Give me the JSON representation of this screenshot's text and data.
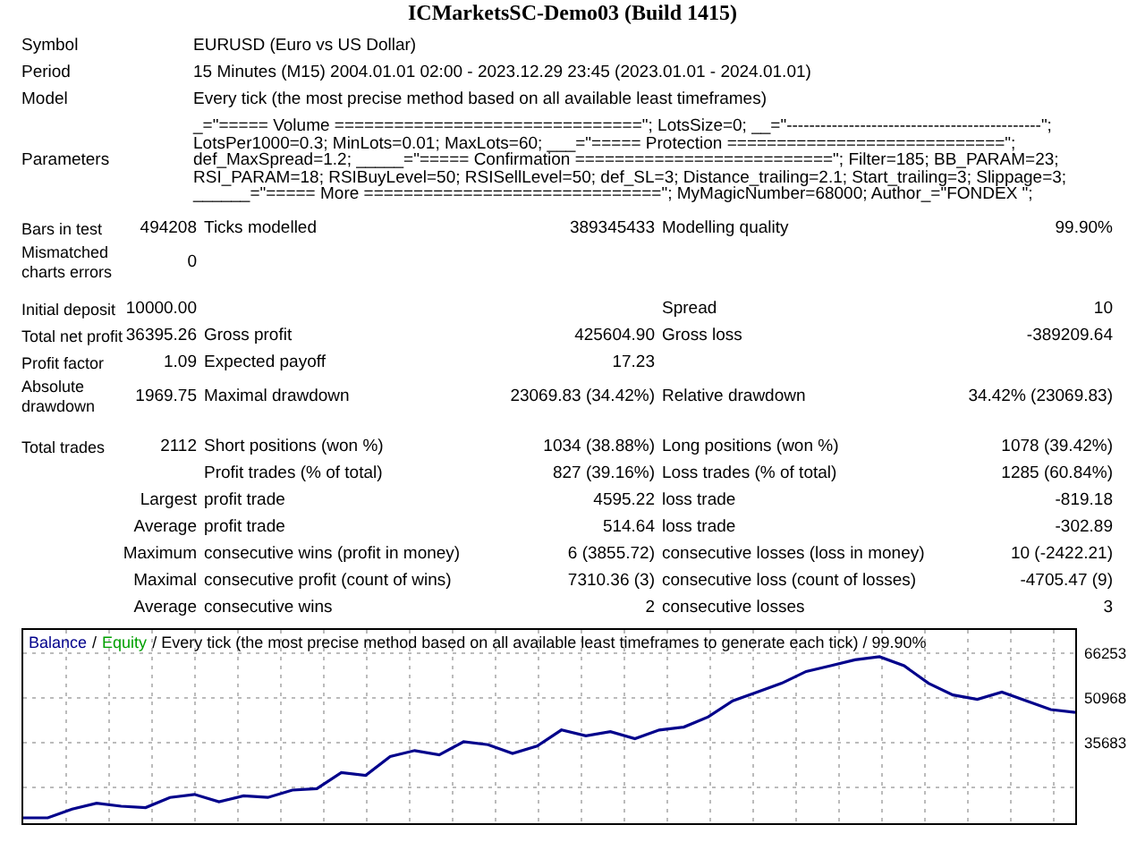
{
  "title": "ICMarketsSC-Demo03 (Build 1415)",
  "info": [
    {
      "label": "Symbol",
      "value": "EURUSD (Euro vs US Dollar)"
    },
    {
      "label": "Period",
      "value": "15 Minutes (M15) 2004.01.01 02:00 - 2023.12.29 23:45 (2023.01.01 - 2024.01.01)"
    },
    {
      "label": "Model",
      "value": "Every tick (the most precise method based on all available least timeframes)"
    },
    {
      "label": "Parameters",
      "value": "_=\"===== Volume ===============================\"; LotsSize=0; __=\"---------------------------------------------\"; LotsPer1000=0.3; MinLots=0.01; MaxLots=60; ___=\"===== Protection ============================\"; def_MaxSpread=1.2; _____=\"===== Confirmation ==========================\"; Filter=185; BB_PARAM=23; RSI_PARAM=18; RSIBuyLevel=50; RSISellLevel=50; def_SL=3; Distance_trailing=2.1; Start_trailing=3; Slippage=3; ______=\"===== More ==============================\"; MyMagicNumber=68000; Author_=\"FONDEX \";"
    }
  ],
  "stats": [
    {
      "label": "Bars in test",
      "value": "494208",
      "label_2": "Ticks modelled",
      "value_2": "389345433",
      "label_3": "Modelling quality",
      "value_3": "99.90%"
    },
    {
      "label": "Mismatched charts errors",
      "value": "0"
    },
    {
      "label": "Initial deposit",
      "value": "10000.00",
      "label_3": "Spread",
      "value_3": "10"
    },
    {
      "label": "Total net profit",
      "value": "36395.26",
      "label_2": "Gross profit",
      "value_2": "425604.90",
      "label_3": "Gross loss",
      "value_3": "-389209.64"
    },
    {
      "label": "Profit factor",
      "value": "1.09",
      "label_2": "Expected payoff",
      "value_2": "17.23"
    },
    {
      "label": "Absolute drawdown",
      "value": "1969.75",
      "label_2": "Maximal drawdown",
      "value_2": "23069.83 (34.42%)",
      "label_3": "Relative drawdown",
      "value_3": "34.42% (23069.83)"
    },
    {
      "label": "Total trades",
      "value": "2112",
      "label_2": "Short positions (won %)",
      "value_2": "1034 (38.88%)",
      "label_3": "Long positions (won %)",
      "value_3": "1078 (39.42%)"
    },
    {
      "label_2": "Profit trades (% of total)",
      "value_2": "827 (39.16%)",
      "label_3": "Loss trades (% of total)",
      "value_3": "1285 (60.84%)"
    },
    {
      "value": "Largest",
      "label_2": "profit trade",
      "value_2": "4595.22",
      "label_3": "loss trade",
      "value_3": "-819.18"
    },
    {
      "value": "Average",
      "label_2": "profit trade",
      "value_2": "514.64",
      "label_3": "loss trade",
      "value_3": "-302.89"
    },
    {
      "value": "Maximum",
      "label_2": "consecutive wins (profit in money)",
      "value_2": "6 (3855.72)",
      "label_3": "consecutive losses (loss in money)",
      "value_3": "10 (-2422.21)"
    },
    {
      "value": "Maximal",
      "label_2": "consecutive profit (count of wins)",
      "value_2": "7310.36 (3)",
      "label_3": "consecutive loss (count of losses)",
      "value_3": "-4705.47 (9)"
    },
    {
      "value": "Average",
      "label_2": "consecutive wins",
      "value_2": "2",
      "label_3": "consecutive losses",
      "value_3": "3"
    }
  ],
  "chart": {
    "legend_separator": "/",
    "legend_equity": "Equity",
    "legend_rest": "/ Every tick (the most precise method based on all available least timeframes to generate each tick) / 99.90%",
    "chart_data": {
      "type": "line",
      "ylim": [
        8170,
        74201
      ],
      "yticks": [
        66253,
        50968,
        35683
      ],
      "grid": true,
      "series": [
        {
          "name": "Balance",
          "color": "#00008b",
          "values": [
            10000,
            10000,
            13000,
            15000,
            14000,
            13500,
            17000,
            18000,
            15500,
            17500,
            17000,
            19500,
            20000,
            25500,
            24500,
            31000,
            33000,
            31500,
            36000,
            35000,
            32000,
            34500,
            40000,
            38000,
            39500,
            37000,
            40000,
            41000,
            44500,
            50000,
            53000,
            56000,
            60000,
            62000,
            64000,
            65000,
            62000,
            56000,
            52000,
            50500,
            53000,
            50000,
            47000,
            46000
          ]
        }
      ]
    }
  }
}
